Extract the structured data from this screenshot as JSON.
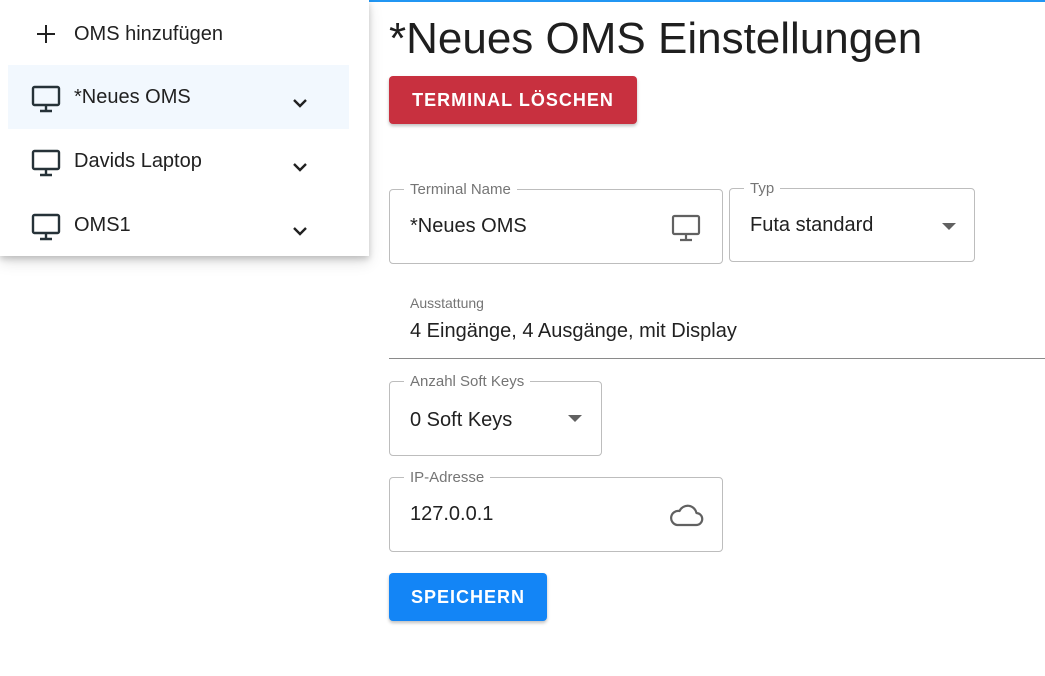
{
  "sidebar": {
    "add_label": "OMS hinzufügen",
    "items": [
      {
        "label": "*Neues OMS",
        "active": true,
        "icon": "monitor-icon"
      },
      {
        "label": "Davids Laptop",
        "active": false,
        "icon": "monitor-icon"
      },
      {
        "label": "OMS1",
        "active": false,
        "icon": "monitor-icon"
      }
    ]
  },
  "main": {
    "title": "*Neues OMS Einstellungen",
    "delete_button": "TERMINAL LÖSCHEN",
    "terminal_name": {
      "label": "Terminal Name",
      "value": "*Neues OMS",
      "icon": "monitor-icon"
    },
    "typ": {
      "label": "Typ",
      "value": "Futa standard"
    },
    "ausstattung": {
      "label": "Ausstattung",
      "value": "4 Eingänge, 4 Ausgänge, mit Display"
    },
    "soft_keys": {
      "label": "Anzahl Soft Keys",
      "value": "0 Soft Keys"
    },
    "ip": {
      "label": "IP-Adresse",
      "value": "127.0.0.1",
      "icon": "cloud-icon"
    },
    "save_button": "SPEICHERN"
  },
  "colors": {
    "accent": "#2196f3",
    "delete": "#c8303f",
    "save": "#1385f6",
    "active_bg": "#f2f8fe"
  }
}
